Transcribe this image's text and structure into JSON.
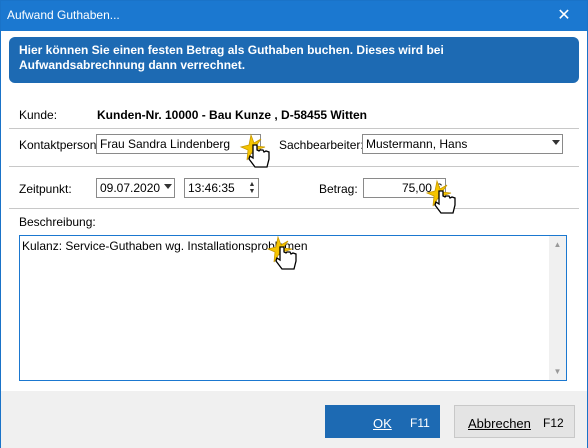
{
  "window": {
    "title": "Aufwand Guthaben...",
    "close_glyph": "✕"
  },
  "banner": {
    "text": "Hier können Sie einen festen Betrag als Guthaben buchen. Dieses wird bei Aufwandsabrechnung dann verrechnet."
  },
  "kunde": {
    "label": "Kunde:",
    "value": "Kunden-Nr. 10000 - Bau Kunze , D-58455  Witten"
  },
  "kontakt": {
    "label": "Kontaktperson:",
    "value": "Frau Sandra Lindenberg"
  },
  "sachbearbeiter": {
    "label": "Sachbearbeiter:",
    "value": "Mustermann, Hans"
  },
  "zeitpunkt": {
    "label": "Zeitpunkt:",
    "date": "09.07.2020",
    "time": "13:46:35"
  },
  "betrag": {
    "label": "Betrag:",
    "value": "75,00 €"
  },
  "beschreibung": {
    "label": "Beschreibung:",
    "value": "Kulanz: Service-Guthaben wg. Installationsproblemen"
  },
  "buttons": {
    "ok": {
      "label": "OK",
      "shortcut": "F11"
    },
    "cancel": {
      "label": "Abbrechen",
      "shortcut": "F12"
    }
  },
  "colors": {
    "accent": "#1b78d0",
    "banner": "#1d6ab3"
  },
  "icons": [
    "close-icon",
    "dropdown-arrow-icon",
    "spin-icon",
    "scroll-up-icon",
    "scroll-down-icon",
    "hand-cursor-icon"
  ]
}
